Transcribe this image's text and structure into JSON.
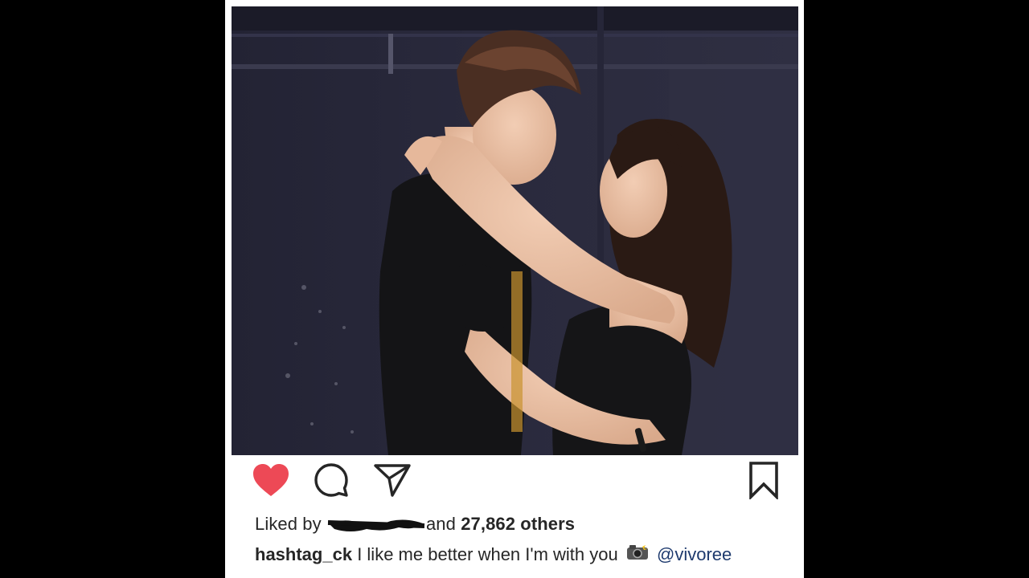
{
  "post": {
    "liked_by_prefix": "Liked by",
    "liked_by_suffix": "and",
    "likes_count_text": "27,862 others",
    "caption_username": "hashtag_ck",
    "caption_text": "I like me better when I'm with you",
    "caption_emoji": "camera-with-flash",
    "caption_mention": "@vivoree",
    "liked": true
  },
  "icons": {
    "like": "heart-icon",
    "comment": "comment-bubble-icon",
    "share": "paper-plane-icon",
    "save": "bookmark-icon"
  },
  "colors": {
    "heart": "#ed4956",
    "text": "#262626",
    "mention": "#1e3a6e",
    "backdrop": "#000000"
  }
}
